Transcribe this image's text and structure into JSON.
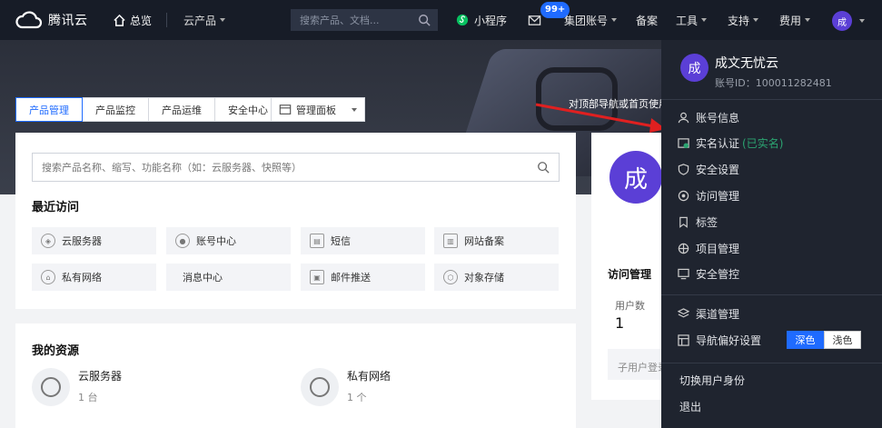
{
  "brand": {
    "name": "腾讯云"
  },
  "topnav": {
    "overview": "总览",
    "products": "云产品",
    "search_placeholder": "搜索产品、文档...",
    "mini_program": "小程序",
    "message_badge": "99+",
    "group_account": "集团账号",
    "filing": "备案",
    "tools": "工具",
    "support": "支持",
    "billing": "费用",
    "avatar_char": "成"
  },
  "hero": {
    "tip": "对顶部导航或首页使用"
  },
  "tabs": [
    "产品管理",
    "产品监控",
    "产品运维",
    "安全中心"
  ],
  "dashboard_button": "管理面板",
  "main": {
    "search_placeholder": "搜索产品名称、缩写、功能名称（如：云服务器、快照等）",
    "recent_title": "最近访问",
    "recent": [
      {
        "label": "云服务器",
        "icon": "cloud-server-icon"
      },
      {
        "label": "账号中心",
        "icon": "user-center-icon"
      },
      {
        "label": "短信",
        "icon": "sms-icon"
      },
      {
        "label": "网站备案",
        "icon": "website-filing-icon"
      },
      {
        "label": "私有网络",
        "icon": "vpc-icon"
      },
      {
        "label": "消息中心",
        "icon": "message-center-icon"
      },
      {
        "label": "邮件推送",
        "icon": "email-push-icon"
      },
      {
        "label": "对象存储",
        "icon": "object-storage-icon"
      }
    ],
    "resources_title": "我的资源",
    "resources": [
      {
        "name": "云服务器",
        "count": "1 台"
      },
      {
        "name": "私有网络",
        "count": "1 个"
      }
    ]
  },
  "side": {
    "avatar_char": "成",
    "access_title": "访问管理",
    "user_label": "用户数",
    "user_value": "1",
    "user_login": "子用户登录"
  },
  "panel": {
    "avatar_char": "成",
    "name": "成文无忧云",
    "account_id": "账号ID：100011282481",
    "items": [
      {
        "label": "账号信息",
        "icon": "user-icon"
      },
      {
        "label": "实名认证",
        "icon": "id-card-icon",
        "status": "(已实名)"
      },
      {
        "label": "安全设置",
        "icon": "shield-icon"
      },
      {
        "label": "访问管理",
        "icon": "access-icon"
      },
      {
        "label": "标签",
        "icon": "bookmark-icon"
      },
      {
        "label": "项目管理",
        "icon": "project-icon"
      },
      {
        "label": "安全管控",
        "icon": "monitor-icon"
      }
    ],
    "channel": "渠道管理",
    "nav_pref": "导航偏好设置",
    "theme_dark": "深色",
    "theme_light": "浅色",
    "switch_identity": "切换用户身份",
    "logout": "退出"
  },
  "colors": {
    "accent": "#1f6bff",
    "nav_bg": "#171c27",
    "panel_bg": "#1f242f",
    "avatar": "#5b3fd6",
    "verified": "#2ba471"
  }
}
